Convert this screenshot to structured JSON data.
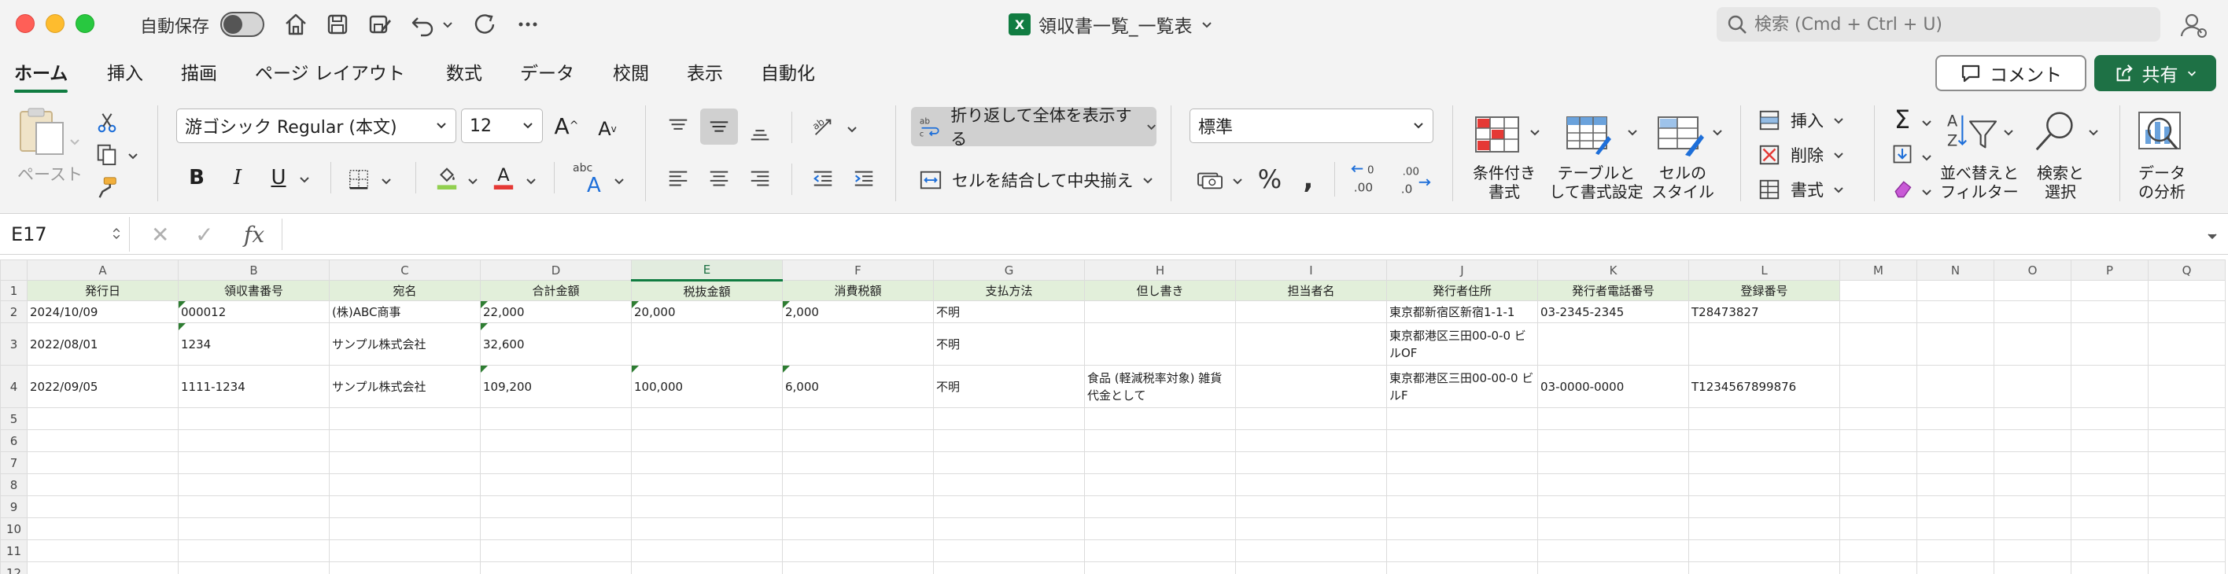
{
  "titlebar": {
    "autosave_label": "自動保存",
    "doc_title": "領収書一覧_一覧表",
    "search_placeholder": "検索 (Cmd + Ctrl + U)"
  },
  "menu": {
    "tabs": [
      "ホーム",
      "挿入",
      "描画",
      "ページ レイアウト",
      "数式",
      "データ",
      "校閲",
      "表示",
      "自動化"
    ],
    "comment_label": "コメント",
    "share_label": "共有"
  },
  "ribbon": {
    "paste_label": "ペースト",
    "font_name": "游ゴシック Regular (本文)",
    "font_size": "12",
    "bold": "B",
    "italic": "I",
    "underline": "U",
    "wrap_text": "折り返して全体を表示する",
    "merge_center": "セルを結合して中央揃え",
    "number_format": "標準",
    "conditional_format": [
      "条件付き",
      "書式"
    ],
    "format_as_table": [
      "テーブルと",
      "して書式設定"
    ],
    "cell_styles": [
      "セルの",
      "スタイル"
    ],
    "insert": "挿入",
    "delete": "削除",
    "format": "書式",
    "sort_filter": [
      "並べ替えと",
      "フィルター"
    ],
    "find_select": [
      "検索と",
      "選択"
    ],
    "analyze_data": [
      "データ",
      "の分析"
    ]
  },
  "formula": {
    "name_box": "E17",
    "fx": "fx"
  },
  "sheet": {
    "columns": [
      "A",
      "B",
      "C",
      "D",
      "E",
      "F",
      "G",
      "H",
      "I",
      "J",
      "K",
      "L",
      "M",
      "N",
      "O",
      "P",
      "Q"
    ],
    "selected_column": "E",
    "header_row": [
      "発行日",
      "領収書番号",
      "宛名",
      "合計金額",
      "税抜金額",
      "消費税額",
      "支払方法",
      "但し書き",
      "担当者名",
      "発行者住所",
      "発行者電話番号",
      "登録番号"
    ],
    "rows": [
      [
        "2024/10/09",
        "000012",
        "(株)ABC商事",
        "22,000",
        "20,000",
        "2,000",
        "不明",
        "",
        "",
        "東京都新宿区新宿1-1-1",
        "03-2345-2345",
        "T28473827"
      ],
      [
        "2022/08/01",
        "1234",
        "サンプル株式会社",
        "32,600",
        "",
        "",
        "不明",
        "",
        "",
        "東京都港区三田00-0-0 ビルOF",
        "",
        ""
      ],
      [
        "2022/09/05",
        "1111-1234",
        "サンプル株式会社",
        "109,200",
        "100,000",
        "6,000",
        "不明",
        "食品 (軽減税率対象) 雑貨代金として",
        "",
        "東京都港区三田00-00-0 ビルF",
        "03-0000-0000",
        "T1234567899876"
      ]
    ],
    "row_numbers": [
      "1",
      "2",
      "3",
      "4",
      "5",
      "6",
      "7",
      "8",
      "9",
      "10",
      "11",
      "12"
    ]
  }
}
